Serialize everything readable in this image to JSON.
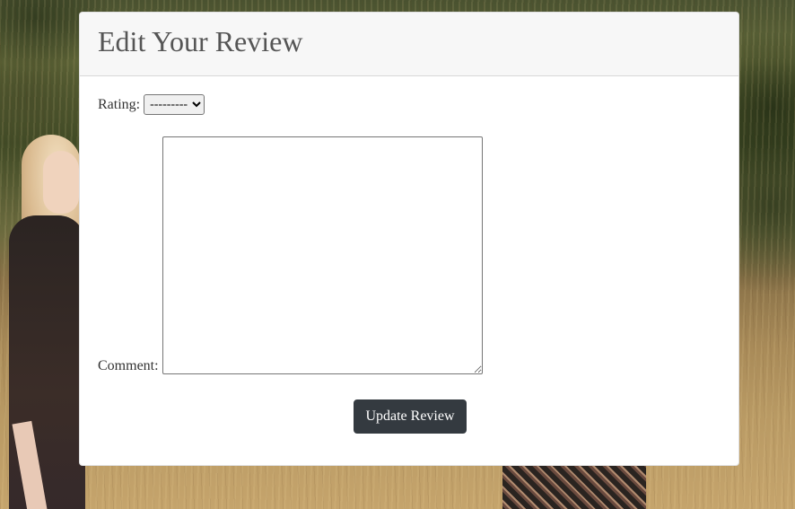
{
  "page": {
    "title": "Edit Your Review"
  },
  "form": {
    "rating_label": "Rating:",
    "rating_selected": "---------",
    "rating_options": [
      "---------"
    ],
    "comment_label": "Comment:",
    "comment_value": "",
    "submit_label": "Update Review"
  },
  "colors": {
    "button_bg": "#343a40",
    "header_bg": "#f7f7f7",
    "title_color": "#555555"
  }
}
